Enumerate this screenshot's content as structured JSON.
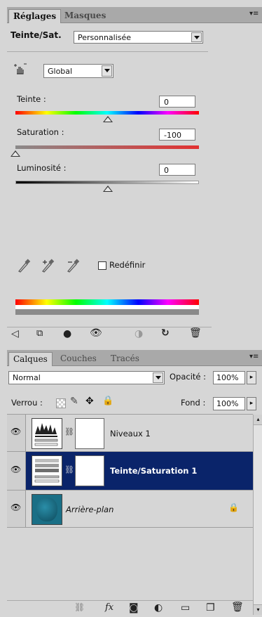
{
  "top_tabs": [
    "Réglages",
    "Masques"
  ],
  "adjust": {
    "title": "Teinte/Sat.",
    "preset": "Personnalisée",
    "range": "Global",
    "hue_label": "Teinte :",
    "hue_value": "0",
    "sat_label": "Saturation :",
    "sat_value": "-100",
    "light_label": "Luminosité :",
    "light_value": "0",
    "colorize_label": "Redéfinir"
  },
  "bottom_tabs": [
    "Calques",
    "Couches",
    "Tracés"
  ],
  "layers_panel": {
    "blend_mode": "Normal",
    "opacity_label": "Opacité :",
    "opacity_value": "100%",
    "lock_label": "Verrou :",
    "fill_label": "Fond :",
    "fill_value": "100%"
  },
  "layers": [
    {
      "name": "Niveaux 1",
      "selected": false
    },
    {
      "name": "Teinte/Saturation 1",
      "selected": true
    },
    {
      "name": "Arrière-plan",
      "selected": false,
      "italic": true,
      "locked": true
    }
  ],
  "colors": {
    "selection": "#0a246a",
    "panel_bg": "#d6d6d6",
    "tab_bar": "#a9a9a9",
    "thumb_teal": "#1a6f86"
  },
  "icons": {
    "panel_menu": "panel-menu-icon",
    "targeted_adjust": "hand-adjust-icon",
    "eyedropper": "eyedropper-icon",
    "eye": "eye-icon",
    "lock": "lock-icon",
    "link": "chain-link-icon"
  }
}
